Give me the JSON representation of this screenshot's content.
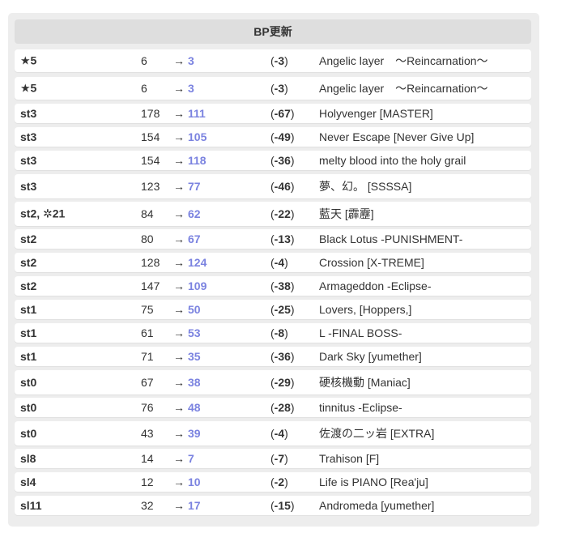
{
  "header": {
    "title": "BP更新"
  },
  "arrow": "→",
  "rows": [
    {
      "level": "★5",
      "old": "6",
      "new": "3",
      "diff": "-3",
      "title": "Angelic layer　〜Reincarnation〜"
    },
    {
      "level": "★5",
      "old": "6",
      "new": "3",
      "diff": "-3",
      "title": "Angelic layer　〜Reincarnation〜"
    },
    {
      "level": "st3",
      "old": "178",
      "new": "111",
      "diff": "-67",
      "title": "Holyvenger [MASTER]"
    },
    {
      "level": "st3",
      "old": "154",
      "new": "105",
      "diff": "-49",
      "title": "Never Escape [Never Give Up]"
    },
    {
      "level": "st3",
      "old": "154",
      "new": "118",
      "diff": "-36",
      "title": "melty blood into the holy grail"
    },
    {
      "level": "st3",
      "old": "123",
      "new": "77",
      "diff": "-46",
      "title": "夢、幻。 [SSSSA]"
    },
    {
      "level": "st2, ✲21",
      "old": "84",
      "new": "62",
      "diff": "-22",
      "title": "藍天 [霹靂]"
    },
    {
      "level": "st2",
      "old": "80",
      "new": "67",
      "diff": "-13",
      "title": "Black Lotus -PUNISHMENT-"
    },
    {
      "level": "st2",
      "old": "128",
      "new": "124",
      "diff": "-4",
      "title": "Crossion [X-TREME]"
    },
    {
      "level": "st2",
      "old": "147",
      "new": "109",
      "diff": "-38",
      "title": "Armageddon -Eclipse-"
    },
    {
      "level": "st1",
      "old": "75",
      "new": "50",
      "diff": "-25",
      "title": "Lovers, [Hoppers,]"
    },
    {
      "level": "st1",
      "old": "61",
      "new": "53",
      "diff": "-8",
      "title": "L -FINAL BOSS-"
    },
    {
      "level": "st1",
      "old": "71",
      "new": "35",
      "diff": "-36",
      "title": "Dark Sky [yumether]"
    },
    {
      "level": "st0",
      "old": "67",
      "new": "38",
      "diff": "-29",
      "title": "硬核機動 [Maniac]"
    },
    {
      "level": "st0",
      "old": "76",
      "new": "48",
      "diff": "-28",
      "title": "tinnitus -Eclipse-"
    },
    {
      "level": "st0",
      "old": "43",
      "new": "39",
      "diff": "-4",
      "title": "佐渡の二ッ岩 [EXTRA]"
    },
    {
      "level": "sl8",
      "old": "14",
      "new": "7",
      "diff": "-7",
      "title": "Trahison [F]"
    },
    {
      "level": "sl4",
      "old": "12",
      "new": "10",
      "diff": "-2",
      "title": "Life is PIANO [Rea'ju]"
    },
    {
      "level": "sl11",
      "old": "32",
      "new": "17",
      "diff": "-15",
      "title": "Andromeda [yumether]"
    }
  ]
}
